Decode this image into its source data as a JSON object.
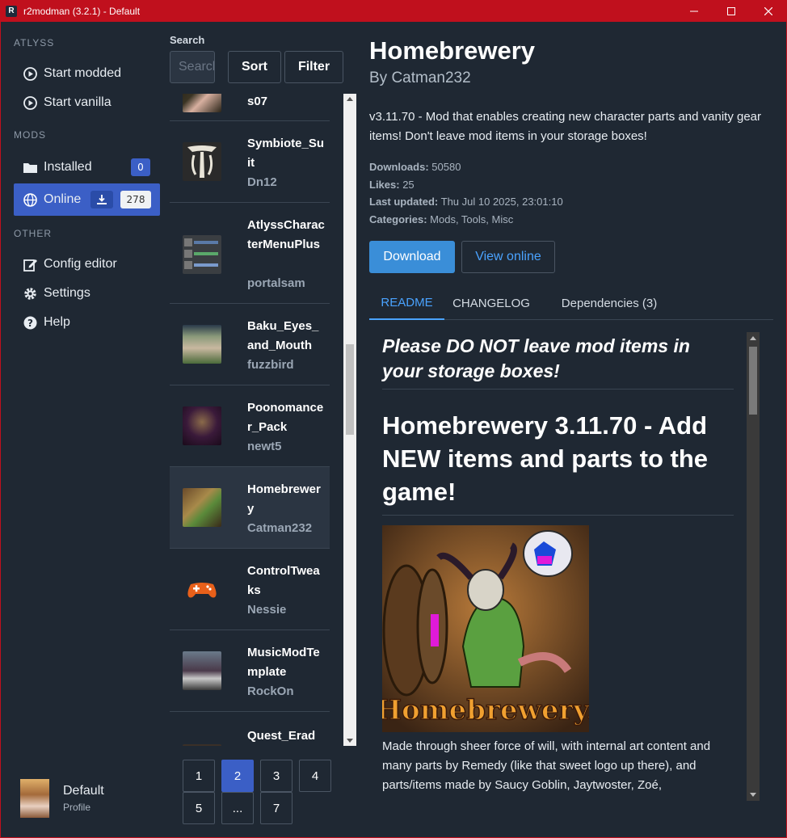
{
  "window": {
    "title": "r2modman (3.2.1) - Default",
    "app_icon_letter": "R"
  },
  "sidebar": {
    "sections": {
      "game": "ATLYSS",
      "mods": "MODS",
      "other": "OTHER"
    },
    "items": {
      "start_modded": "Start modded",
      "start_vanilla": "Start vanilla",
      "installed": "Installed",
      "installed_count": "0",
      "online": "Online",
      "online_count": "278",
      "config_editor": "Config editor",
      "settings": "Settings",
      "help": "Help"
    },
    "profile": {
      "name": "Default",
      "label": "Profile"
    }
  },
  "search": {
    "label": "Search",
    "placeholder": "Search",
    "sort_label": "Sort",
    "filter_label": "Filter"
  },
  "mods": [
    {
      "name": "s07",
      "author": ""
    },
    {
      "name": "Symbiote_Suit",
      "author": "Dn12"
    },
    {
      "name": "AtlyssCharacterMenuPlus",
      "author": "portalsam"
    },
    {
      "name": "Baku_Eyes_and_Mouth",
      "author": "fuzzbird"
    },
    {
      "name": "Poonomancer_Pack",
      "author": "newt5"
    },
    {
      "name": "Homebrewery",
      "author": "Catman232"
    },
    {
      "name": "ControlTweaks",
      "author": "Nessie"
    },
    {
      "name": "MusicModTemplate",
      "author": "RockOn"
    },
    {
      "name": "Quest_Erad",
      "author": ""
    }
  ],
  "pagination": {
    "pages": [
      "1",
      "2",
      "3",
      "4",
      "5",
      "...",
      "7"
    ],
    "current": "2"
  },
  "detail": {
    "title": "Homebrewery",
    "by": "By Catman232",
    "description": "v3.11.70 - Mod that enables creating new character parts and vanity gear items! Don't leave mod items in your storage boxes!",
    "downloads_label": "Downloads:",
    "downloads": "50580",
    "likes_label": "Likes:",
    "likes": "25",
    "updated_label": "Last updated:",
    "updated": "Thu Jul 10 2025, 23:01:10",
    "categories_label": "Categories:",
    "categories": "Mods, Tools, Misc",
    "download_button": "Download",
    "view_online_button": "View online",
    "tabs": [
      "README",
      "CHANGELOG",
      "Dependencies (3)"
    ],
    "active_tab": "README"
  },
  "readme": {
    "notice": "Please DO NOT leave mod items in your storage boxes!",
    "heading": "Homebrewery 3.11.70 - Add NEW items and parts to the game!",
    "logo_text": "Homebrewery.",
    "paragraph": "Made through sheer force of will, with internal art content and many parts by Remedy (like that sweet logo up there), and parts/items made by Saucy Goblin, Jaytwoster, Zoé,"
  },
  "colors": {
    "titlebar": "#c0101d",
    "background": "#1f2833",
    "accent": "#3b5fc6",
    "link": "#4aa3ff",
    "download": "#3a8ed8"
  }
}
